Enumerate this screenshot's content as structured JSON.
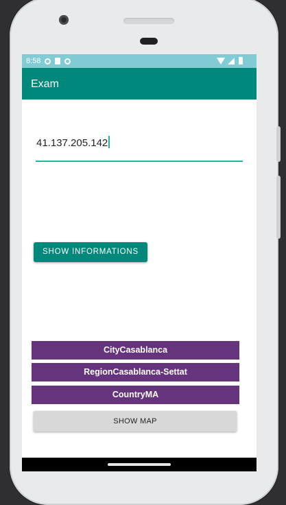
{
  "status_bar": {
    "time": "8:58",
    "left_icons": [
      "settings-icon",
      "settings-icon",
      "sd-card-icon",
      "settings-icon"
    ],
    "right_icons": [
      "wifi-icon",
      "cell-signal-icon",
      "battery-icon"
    ]
  },
  "app_bar": {
    "title": "Exam",
    "color": "#00897b"
  },
  "ip_field": {
    "value": "41.137.205.142",
    "underline_color": "#26b3a7"
  },
  "show_info_button": {
    "label": "SHOW INFORMATIONS"
  },
  "results": {
    "city": "CityCasablanca",
    "region": "RegionCasablanca-Settat",
    "country": "CountryMA",
    "color": "#65347d"
  },
  "show_map_button": {
    "label": "SHOW MAP"
  }
}
